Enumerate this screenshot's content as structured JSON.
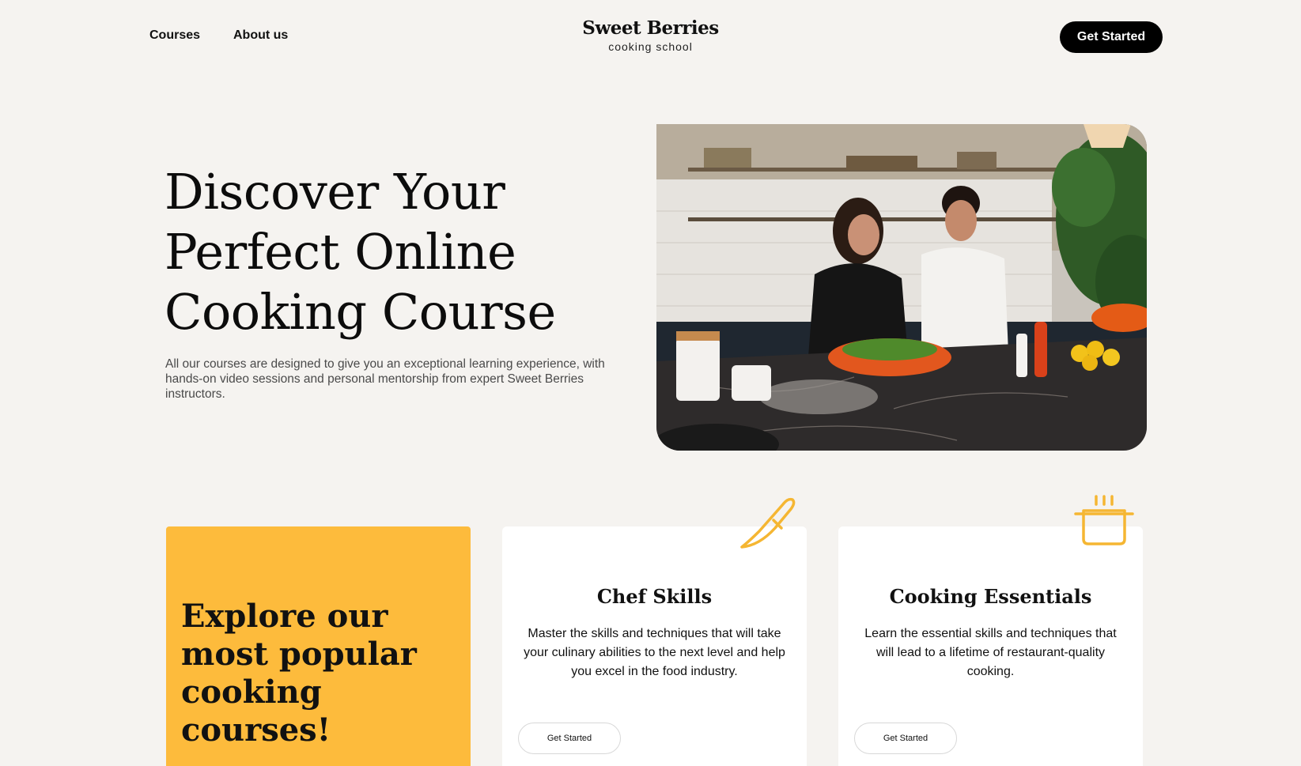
{
  "header": {
    "nav": [
      {
        "label": "Courses"
      },
      {
        "label": "About us"
      }
    ],
    "brand_name": "Sweet Berries",
    "brand_sub": "cooking school",
    "cta": "Get Started"
  },
  "hero": {
    "title": "Discover Your Perfect Online Cooking Course",
    "description": "All our courses are designed to give you an exceptional learning experience, with hands-on video sessions and personal mentorship from expert Sweet Berries instructors.",
    "image": "kitchen-cooking-photo"
  },
  "courses": {
    "intro_title": "Explore our most popular cooking courses!",
    "cards": [
      {
        "title": "Chef Skills",
        "text": "Master the skills and techniques that will take your culinary abilities to the next level and help you excel in the food industry.",
        "button": "Get Started",
        "icon": "knife-icon"
      },
      {
        "title": "Cooking Essentials",
        "text": "Learn the essential skills and techniques that will lead to a lifetime of restaurant-quality cooking.",
        "button": "Get Started",
        "icon": "pot-icon"
      }
    ]
  },
  "colors": {
    "background": "#f5f3f0",
    "accent": "#fdbb3c",
    "cta": "#000000"
  }
}
